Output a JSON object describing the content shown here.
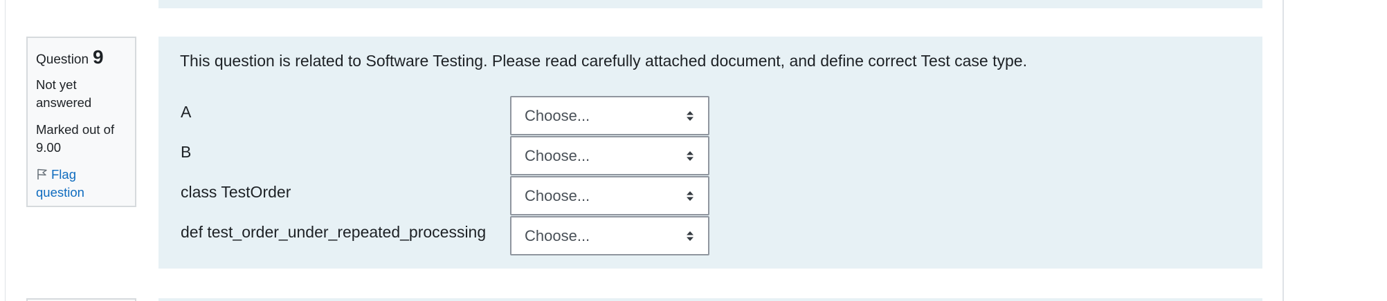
{
  "question": {
    "number_word": "Question",
    "number": "9",
    "state": "Not yet answered",
    "grade": "Marked out of 9.00",
    "flag_label": "Flag question",
    "text": "This question is related to Software Testing. Please read carefully attached document, and define correct Test case type."
  },
  "matches": [
    {
      "label": "A",
      "selected": "Choose..."
    },
    {
      "label": "B",
      "selected": "Choose..."
    },
    {
      "label": "class TestOrder",
      "selected": "Choose..."
    },
    {
      "label": "def test_order_under_repeated_processing",
      "selected": "Choose..."
    }
  ],
  "colors": {
    "content_bg": "#e7f1f5",
    "info_bg": "#f8f9fa",
    "link": "#0f6cbf",
    "text": "#1d2125"
  },
  "icons": {
    "flag": "flag-icon",
    "select_caret": "sort-arrows-icon"
  }
}
